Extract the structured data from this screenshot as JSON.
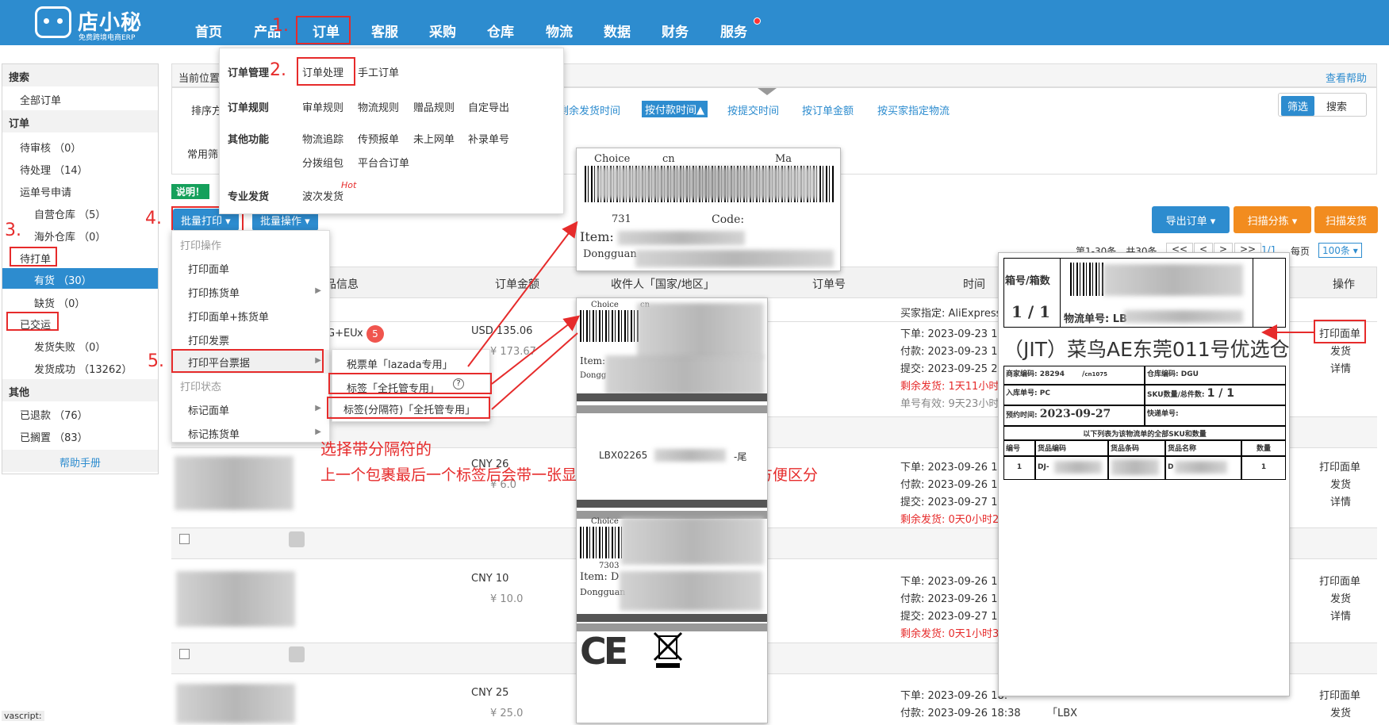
{
  "brand": {
    "name": "店小秘",
    "slogan": "免费跨境电商ERP"
  },
  "nav": [
    "首页",
    "产品",
    "订单",
    "客服",
    "采购",
    "仓库",
    "物流",
    "数据",
    "财务",
    "服务"
  ],
  "steps": {
    "s1": "1.",
    "s2": "2.",
    "s3": "3.",
    "s4": "4.",
    "s5": "5."
  },
  "sidebar": {
    "search_head": "搜索",
    "all_orders": "全部订单",
    "order_head": "订单",
    "items": [
      "待审核 （0）",
      "待处理 （14）",
      "运单号申请",
      "自营仓库 （5）",
      "海外仓库 （0）",
      "待打单",
      "有货 （30）",
      "缺货 （0）",
      "已交运",
      "发货失败 （0）",
      "发货成功 （13262）"
    ],
    "other_head": "其他",
    "other_items": [
      "已退款 （76）",
      "已搁置 （83）"
    ],
    "help": "帮助手册"
  },
  "crumb": {
    "label": "当前位置",
    "help": "查看帮助"
  },
  "sort": {
    "label": "排序方",
    "options": [
      "剩余发货时间",
      "按付款时间▲",
      "按提交时间",
      "按订单金额",
      "按买家指定物流"
    ],
    "filter": "筛选",
    "search": "搜索"
  },
  "common_filter": "常用筛",
  "explain": "说明！",
  "order_menu": {
    "manage": "订单管理",
    "process": "订单处理",
    "manual": "手工订单",
    "rules": "订单规则",
    "rule_items": [
      "审单规则",
      "物流规则",
      "赠品规则",
      "自定导出"
    ],
    "other": "其他功能",
    "other_items": [
      "物流追踪",
      "传预报单",
      "未上网单",
      "补录单号",
      "分拨组包",
      "平台合订单"
    ],
    "pro": "专业发货",
    "wave": "波次发货",
    "hot": "Hot"
  },
  "toolbar": {
    "batch_print": "批量打印 ▾",
    "batch_op": "批量操作 ▾",
    "export": "导出订单 ▾",
    "scan_sort": "扫描分拣 ▾",
    "scan_ship": "扫描发货"
  },
  "paging": {
    "range": "第1-30条，共30条",
    "prev2": "<<",
    "prev": "<",
    "next": ">",
    "next2": ">>",
    "page": "1/1",
    "per": "每页",
    "size": "100条 ▾"
  },
  "print_menu": {
    "ops_head": "打印操作",
    "ops": [
      "打印面单",
      "打印拣货单",
      "打印面单+拣货单",
      "打印发票",
      "打印平台票据"
    ],
    "status_head": "打印状态",
    "status": [
      "标记面单",
      "标记拣货单"
    ]
  },
  "sub_menu": [
    "税票单「lazada专用」",
    "标签「全托管专用」",
    "标签(分隔符)「全托管专用」"
  ],
  "table_head": [
    "品信息",
    "订单金额",
    "收件人「国家/地区」",
    "订单号",
    "时间",
    "操作"
  ],
  "buyer_assign": "买家指定:  AliExpress",
  "rows": [
    {
      "amount": "USD 135.06",
      "sub": "¥ 173.67",
      "t1": "下单: 2023-09-23 12",
      "t2": "付款: 2023-09-23 12",
      "t3": "提交: 2023-09-25 22",
      "t4": "剩余发货: 1天11小时",
      "t5": "单号有效: 9天23小时",
      "tag": "G+EU",
      "tagx": "x",
      "badge": "5",
      "ops": [
        "打印面单",
        "发货",
        "详情"
      ]
    },
    {
      "amount": "CNY 26",
      "sub": "¥ 6.0",
      "t1": "下单: 2023-09-26 16",
      "t2": "付款: 2023-09-26 16",
      "t3": "提交: 2023-09-27 15",
      "t4": "剩余发货: 0天0小时2",
      "ops": [
        "打印面单",
        "发货",
        "详情"
      ]
    },
    {
      "amount": "CNY 10",
      "sub": "¥ 10.0",
      "t1": "下单: 2023-09-26 17",
      "t2": "付款: 2023-09-26 17",
      "t3": "提交: 2023-09-27 15",
      "t4": "剩余发货: 0天1小时3",
      "ops": [
        "打印面单",
        "发货",
        "详情"
      ]
    },
    {
      "amount": "CNY 25",
      "sub": "¥ 25.0",
      "t1": "下单: 2023-09-26 18:",
      "t2": "付款: 2023-09-26 18:38",
      "extra": "「LBX",
      "ops": [
        "打印面单",
        "发货"
      ]
    }
  ],
  "annotation": {
    "line1": "选择带分隔符的",
    "line2": "上一个包裹最后一个标签后会带一张显示这个包裹运单号的标签，方便区分"
  },
  "label_top": {
    "choice": "Choice",
    "cn": "cn",
    "ma": "Ma",
    "code": "Code:",
    "num": "731",
    "item": "Item:",
    "city": "Dongguan"
  },
  "label_strip": {
    "choice": "Choice",
    "cn": "cn",
    "item": "Item:",
    "city": "Dongg",
    "lbx": "LBX02265",
    "tail": "-尾",
    "choice2": "Choice",
    "num2": "7303",
    "item2": "Item: D",
    "city2": "Dongguan"
  },
  "jit": {
    "box": "箱号/箱数",
    "box_val": "1 / 1",
    "track": "物流单号: LB",
    "title": "（JIT）菜鸟AE东莞011号优选仓",
    "merchant": "商家编码: 28294",
    "merchant2": "/",
    "merchant3": "cn1075",
    "wh": "仓库编码: DGU",
    "inbound": "入库单号: PC",
    "sku": "SKU数量/总件数:",
    "sku_val": "1  /  1",
    "date_label": "预约时间:",
    "date": "2023-09-27",
    "express": "快递单号:",
    "desc": "以下列表为该物流单的全部SKU和数量",
    "cols": [
      "编号",
      "货品编码",
      "货品条码",
      "货品名称",
      "数量"
    ],
    "row": [
      "1",
      "DJ-",
      "",
      "D",
      "1"
    ]
  },
  "misc": {
    "javascript": "vascript:"
  }
}
